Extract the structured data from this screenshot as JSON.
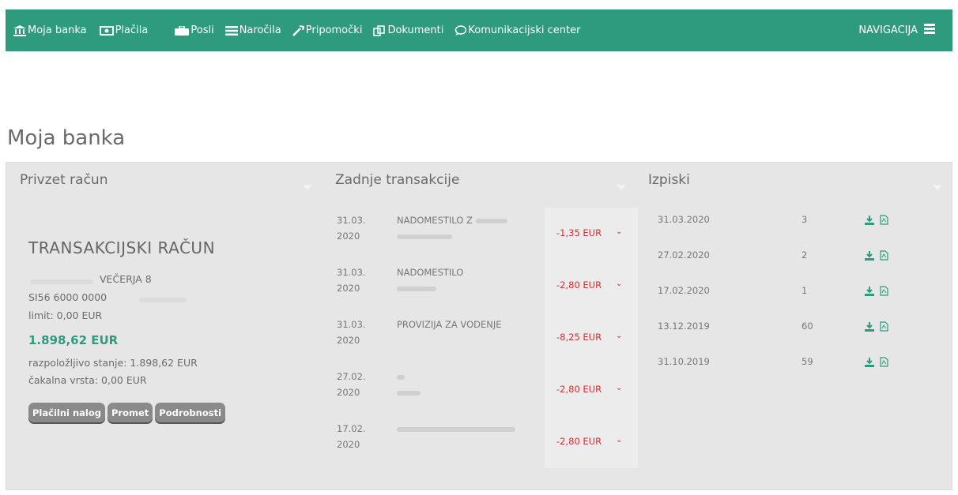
{
  "nav": {
    "items": [
      {
        "label": "Moja banka",
        "icon": "bank-icon"
      },
      {
        "label": "Plačila",
        "icon": "money-icon"
      },
      {
        "label": "Posli",
        "icon": "briefcase-icon"
      },
      {
        "label": "Naročila",
        "icon": "list-icon"
      },
      {
        "label": "Pripomočki",
        "icon": "tools-icon"
      },
      {
        "label": "Dokumenti",
        "icon": "documents-icon"
      },
      {
        "label": "Komunikacijski center",
        "icon": "chat-icon"
      }
    ],
    "right_label": "NAVIGACIJA",
    "menu_icon": "hamburger-icon"
  },
  "page": {
    "title": "Moja banka"
  },
  "account": {
    "header": "Privzet račun",
    "type": "TRANSAKCIJSKI RAČUN",
    "name": "VEČERJA 8",
    "iban": "SI56 6000 0000",
    "limit": "limit: 0,00 EUR",
    "balance": "1.898,62 EUR",
    "available": "razpoložljivo stanje: 1.898,62 EUR",
    "waiting": "čakalna vrsta: 0,00 EUR",
    "buttons": {
      "payment": "Plačilni nalog",
      "turnover": "Promet",
      "details": "Podrobnosti"
    }
  },
  "transactions": {
    "header": "Zadnje transakcije",
    "rows": [
      {
        "date": "31.03.2020",
        "desc": "NADOMESTILO Z",
        "amount": "-1,35 EUR"
      },
      {
        "date": "31.03.2020",
        "desc": "NADOMESTILO",
        "amount": "-2,80 EUR"
      },
      {
        "date": "31.03.2020",
        "desc": "PROVIZIJA ZA VODENJE",
        "amount": "-8,25 EUR"
      },
      {
        "date": "27.02.2020",
        "desc": "",
        "amount": "-2,80 EUR"
      },
      {
        "date": "17.02.2020",
        "desc": "",
        "amount": "-2,80 EUR"
      }
    ]
  },
  "statements": {
    "header": "Izpiski",
    "rows": [
      {
        "date": "31.03.2020",
        "number": "3"
      },
      {
        "date": "27.02.2020",
        "number": "2"
      },
      {
        "date": "17.02.2020",
        "number": "1"
      },
      {
        "date": "13.12.2019",
        "number": "60"
      },
      {
        "date": "31.10.2019",
        "number": "59"
      }
    ]
  },
  "colors": {
    "brand": "#2e9a7e",
    "negative": "#d03030",
    "button": "#8a8a8a"
  }
}
